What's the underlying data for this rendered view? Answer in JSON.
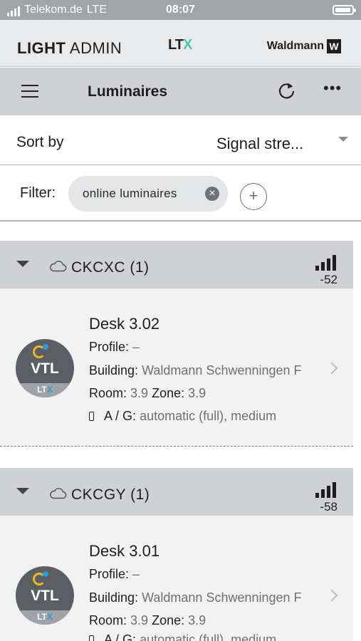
{
  "status_bar": {
    "carrier": "Telekom.de",
    "network": "LTE",
    "time": "08:07",
    "battery_icon": "battery-icon"
  },
  "brand_bar": {
    "title_bold": "LIGHT",
    "title_rest": "ADMIN",
    "ltx_logo_main": "LT",
    "ltx_logo_x": "X",
    "waldmann_logo": "Waldmann",
    "waldmann_mark": "W"
  },
  "nav": {
    "title": "Luminaires",
    "menu_icon": "hamburger-icon",
    "refresh_icon": "refresh-icon",
    "more_icon": "more-icon"
  },
  "sort": {
    "label": "Sort by",
    "value": "Signal stre..."
  },
  "filter": {
    "label": "Filter:",
    "chip_label": "online luminaires",
    "add_icon": "plus-icon"
  },
  "groups": [
    {
      "name": "CKCXC (1)",
      "rssi": "-52",
      "luminaire": {
        "name": "Desk 3.02",
        "profile_label": "Profile:",
        "profile_value": "–",
        "building_label": "Building:",
        "building_value": "Waldmann Schwenningen F",
        "room_label": "Room:",
        "room_value": "3.9",
        "zone_label": "Zone:",
        "zone_value": "3.9",
        "ag_label": "A / G:",
        "ag_value": "automatic (full), medium",
        "avatar_text": "VTL",
        "avatar_band_main": "LT",
        "avatar_band_x": "X"
      }
    },
    {
      "name": "CKCGY (1)",
      "rssi": "-58",
      "luminaire": {
        "name": "Desk 3.01",
        "profile_label": "Profile:",
        "profile_value": "–",
        "building_label": "Building:",
        "building_value": "Waldmann Schwenningen F",
        "room_label": "Room:",
        "room_value": "3.9",
        "zone_label": "Zone:",
        "zone_value": "3.9",
        "ag_label": "A / G:",
        "ag_value": "automatic (full), medium",
        "avatar_text": "VTL",
        "avatar_band_main": "LT",
        "avatar_band_x": "X"
      }
    }
  ],
  "colors": {
    "accent_ltx": "#4cc8a8",
    "group_header_bg": "#cfd1d4",
    "card_bg": "#f2f2f3",
    "value_text": "#6d7073"
  }
}
